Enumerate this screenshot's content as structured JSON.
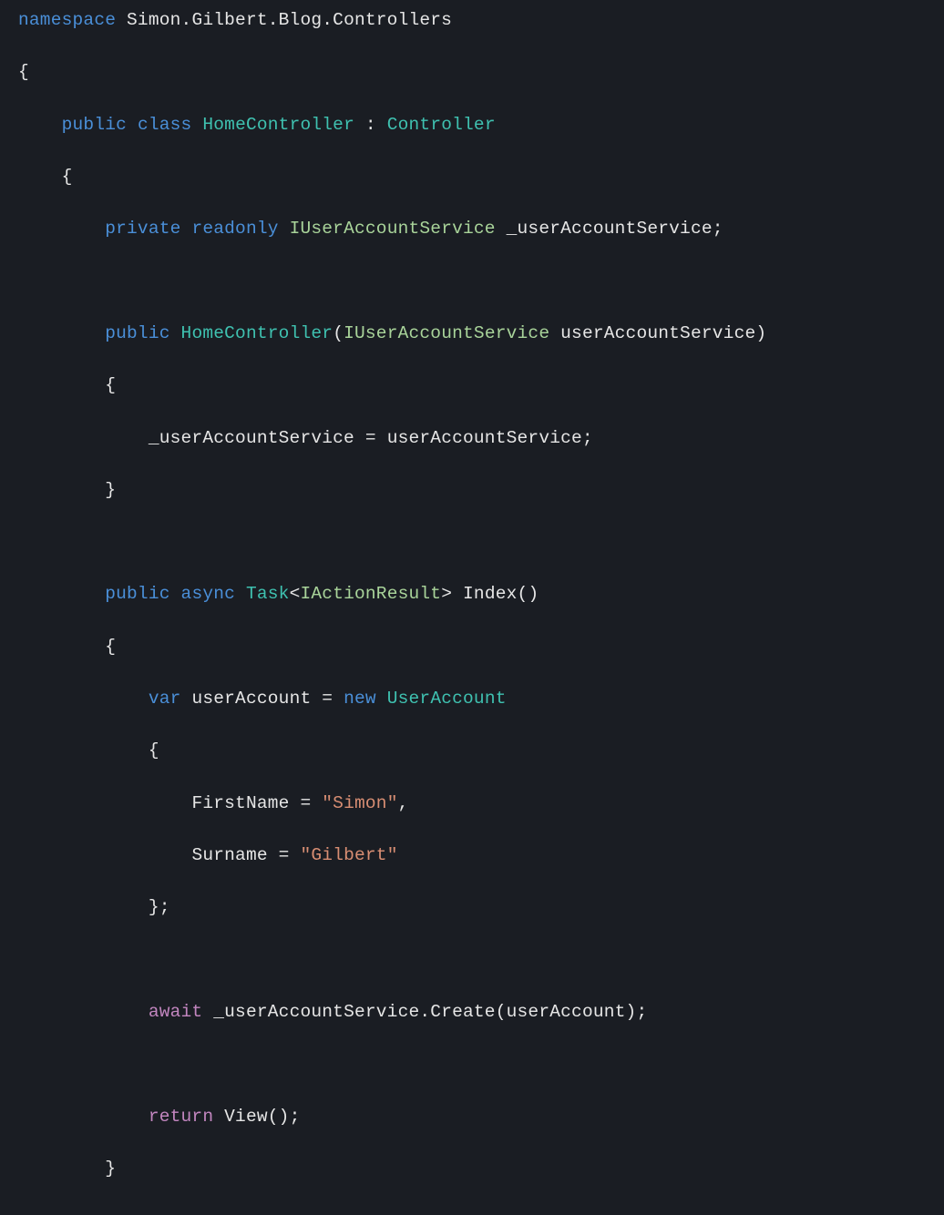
{
  "code": {
    "ns_kw": "namespace",
    "ns_name": "Simon.Gilbert.Blog.Controllers",
    "brace_open": "{",
    "brace_close": "}",
    "public_kw": "public",
    "class_kw": "class",
    "class_name": "HomeController",
    "colon": ":",
    "base_class": "Controller",
    "private_kw": "private",
    "readonly_kw": "readonly",
    "svc_iface": "IUserAccountService",
    "svc_field": "_userAccountService",
    "semicolon": ";",
    "ctor_name": "HomeController",
    "ctor_param_type": "IUserAccountService",
    "ctor_param_name": "userAccountService",
    "assign_stmt_left": "_userAccountService",
    "assign_eq": "=",
    "assign_stmt_right": "userAccountService",
    "async_kw": "async",
    "task_type": "Task",
    "lt": "<",
    "gt": ">",
    "iar_type": "IActionResult",
    "index_name": "Index",
    "empty_parens": "()",
    "var_kw": "var",
    "local_name": "userAccount",
    "new_kw": "new",
    "model_type": "UserAccount",
    "firstname_prop": "FirstName",
    "firstname_val": "\"Simon\"",
    "comma": ",",
    "surname_prop": "Surname",
    "surname_val": "\"Gilbert\"",
    "obj_close": "};",
    "await_kw": "await",
    "svc_call_target": "_userAccountService",
    "dot": ".",
    "create_method": "Create",
    "create_arg": "userAccount",
    "paren_open": "(",
    "paren_close": ")",
    "return_kw": "return",
    "view_call": "View",
    "view_parens": "()",
    "line_end": ";"
  }
}
